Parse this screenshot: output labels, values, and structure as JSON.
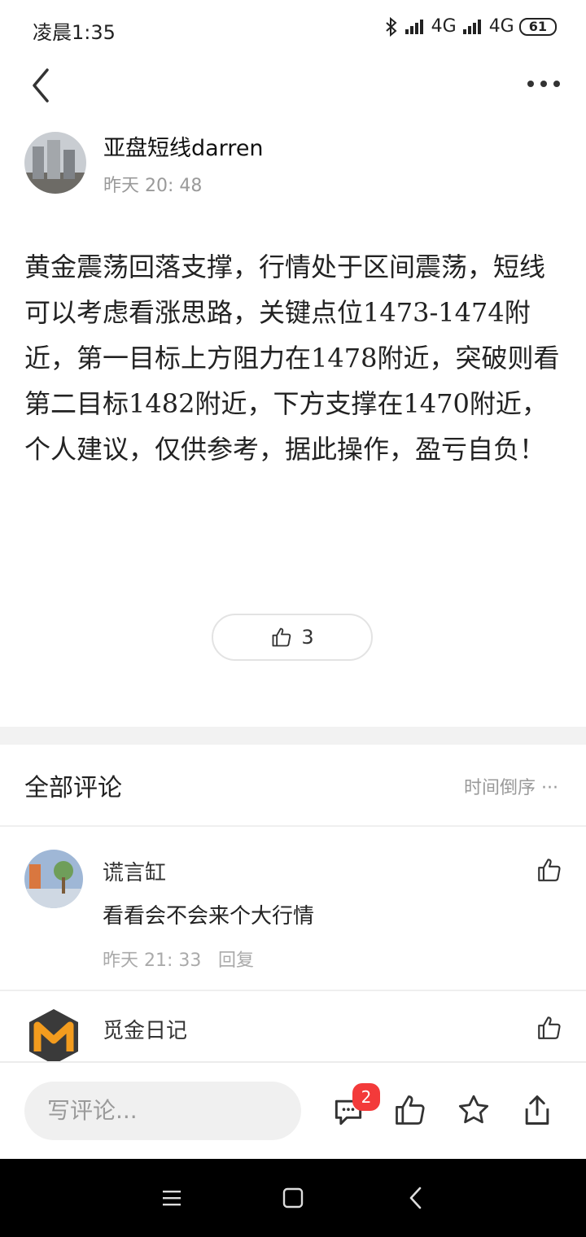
{
  "status_bar": {
    "time": "凌晨1:35",
    "network1": "4G",
    "network2": "4G",
    "battery": "61"
  },
  "post": {
    "author": "亚盘短线darren",
    "time": "昨天 20: 48",
    "content": "黄金震荡回落支撑，行情处于区间震荡，短线可以考虑看涨思路，关键点位1473-1474附近，第一目标上方阻力在1478附近，突破则看第二目标1482附近，下方支撑在1470附近，个人建议，仅供参考，据此操作，盈亏自负！",
    "like_count": "3"
  },
  "comments_section": {
    "title": "全部评论",
    "sort_label": "时间倒序",
    "items": [
      {
        "name": "谎言缸",
        "text": "看看会不会来个大行情",
        "time": "昨天 21: 33",
        "reply_label": "回复"
      },
      {
        "name": "觅金日记"
      }
    ]
  },
  "bottom_bar": {
    "input_placeholder": "写评论...",
    "comment_badge": "2"
  },
  "colors": {
    "badge": "#f33a3a",
    "divider": "#f2f2f2",
    "muted_text": "#9a9a9a"
  }
}
